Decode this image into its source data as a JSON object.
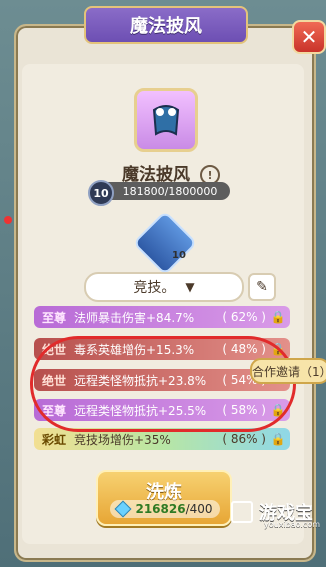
{
  "window": {
    "title": "魔法披风",
    "close_symbol": "✕"
  },
  "item": {
    "name": "魔法披风",
    "info_symbol": "!",
    "level": "10",
    "exp_text": "181800/1800000"
  },
  "rune": {
    "level": "10"
  },
  "selector": {
    "value": "竞技。",
    "arrow": "▼"
  },
  "attributes": [
    {
      "tier": "至尊",
      "text": "法师暴击伤害+84.7%",
      "pct": "( 62% )",
      "lock": "🔒"
    },
    {
      "tier": "绝世",
      "text": "毒系英雄增伤+15.3%",
      "pct": "( 48% )",
      "lock": "🔒"
    },
    {
      "tier": "绝世",
      "text": "远程类怪物抵抗+23.8%",
      "pct": "( 54% )",
      "lock": ""
    },
    {
      "tier": "至尊",
      "text": "远程类怪物抵抗+25.5%",
      "pct": "( 58% )",
      "lock": "🔒"
    },
    {
      "tier": "彩虹",
      "text": "竞技场增伤+35%",
      "pct": "( 86% )",
      "lock": "🔒"
    }
  ],
  "invite_button": {
    "label": "合作邀请（1）"
  },
  "wash_button": {
    "label": "洗炼",
    "have": "216826",
    "need": "/400"
  },
  "watermark": {
    "title": "游戏宝",
    "sub": "youxibao.com"
  },
  "colors": {
    "accent_purple": "#8a6cc8",
    "gold": "#e7a635",
    "close_red": "#c9332a",
    "annotation_red": "#e12b2b"
  }
}
